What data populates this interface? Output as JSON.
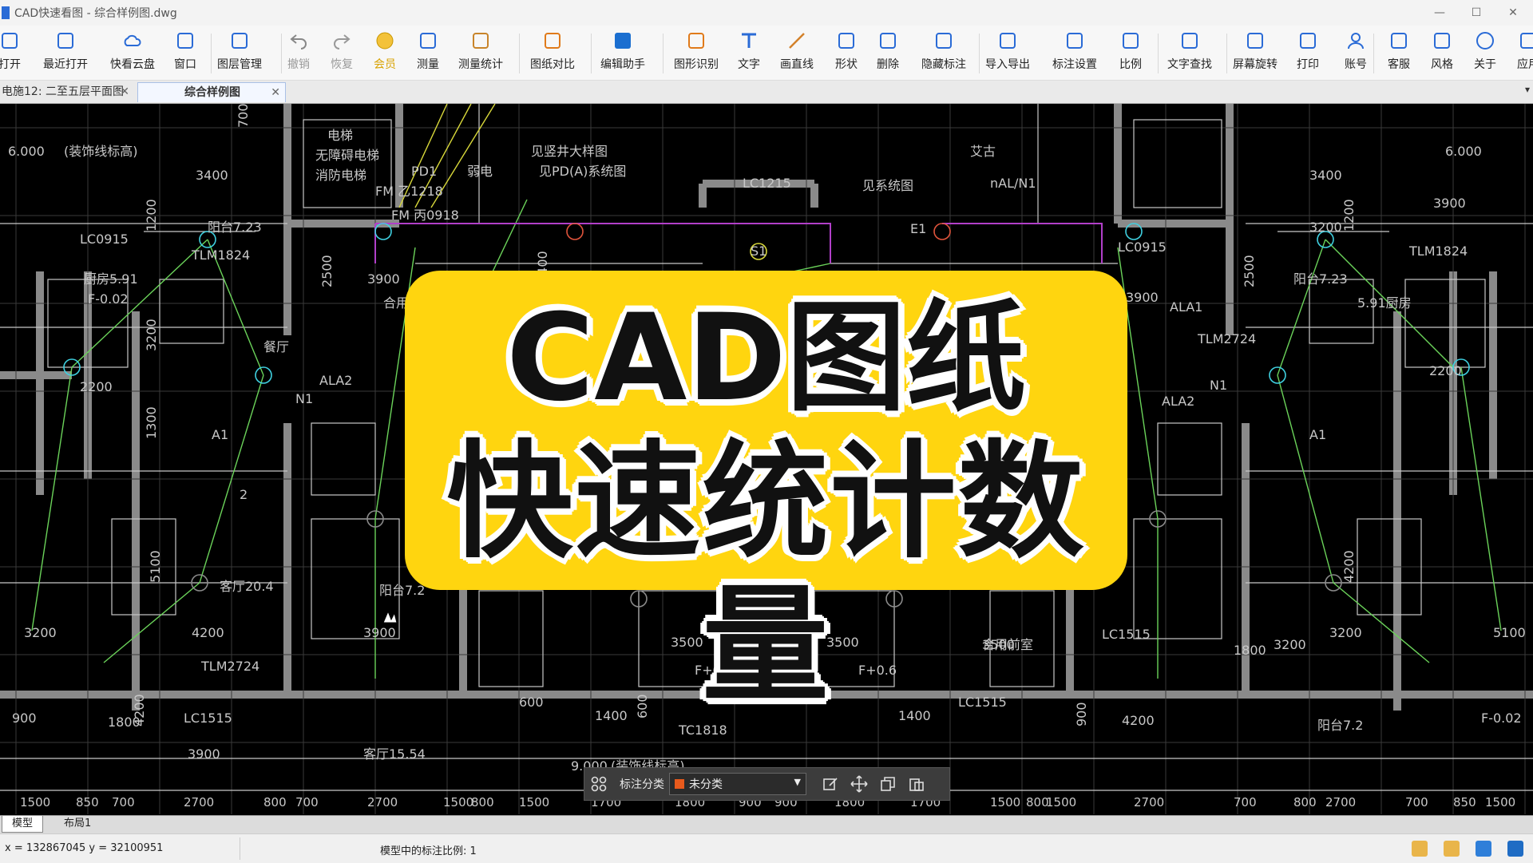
{
  "window": {
    "title": "CAD快速看图 - 综合样例图.dwg",
    "controls": [
      "—",
      "☐",
      "✕"
    ]
  },
  "toolbar": [
    {
      "id": "open",
      "label": "打开",
      "icon": "folder-icon"
    },
    {
      "id": "recent",
      "label": "最近打开",
      "icon": "clock-icon"
    },
    {
      "id": "cloud",
      "label": "快看云盘",
      "icon": "cloud-icon"
    },
    {
      "id": "window",
      "label": "窗口",
      "icon": "window-icon"
    },
    {
      "id": "layers",
      "label": "图层管理",
      "icon": "layers-icon"
    },
    {
      "id": "undo",
      "label": "撤销",
      "icon": "undo-icon"
    },
    {
      "id": "redo",
      "label": "恢复",
      "icon": "redo-icon"
    },
    {
      "id": "vip",
      "label": "会员",
      "icon": "vip-icon"
    },
    {
      "id": "measure",
      "label": "测量",
      "icon": "ruler-icon"
    },
    {
      "id": "measure-stats",
      "label": "测量统计",
      "icon": "chart-icon"
    },
    {
      "id": "compare",
      "label": "图纸对比",
      "icon": "compare-icon"
    },
    {
      "id": "edit-assist",
      "label": "编辑助手",
      "icon": "edit-assistant-icon"
    },
    {
      "id": "shape-recog",
      "label": "图形识别",
      "icon": "shape-recognize-icon"
    },
    {
      "id": "text",
      "label": "文字",
      "icon": "text-icon"
    },
    {
      "id": "line",
      "label": "画直线",
      "icon": "line-icon"
    },
    {
      "id": "shape",
      "label": "形状",
      "icon": "shapes-icon"
    },
    {
      "id": "delete",
      "label": "删除",
      "icon": "eraser-icon"
    },
    {
      "id": "hide-anno",
      "label": "隐藏标注",
      "icon": "eye-hide-icon"
    },
    {
      "id": "import-export",
      "label": "导入导出",
      "icon": "import-export-icon"
    },
    {
      "id": "anno-settings",
      "label": "标注设置",
      "icon": "annotation-settings-icon"
    },
    {
      "id": "scale",
      "label": "比例",
      "icon": "scale-icon"
    },
    {
      "id": "text-search",
      "label": "文字查找",
      "icon": "text-search-icon"
    },
    {
      "id": "rotate",
      "label": "屏幕旋转",
      "icon": "rotate-icon"
    },
    {
      "id": "print",
      "label": "打印",
      "icon": "printer-icon"
    },
    {
      "id": "account",
      "label": "账号",
      "icon": "user-icon"
    },
    {
      "id": "service",
      "label": "客服",
      "icon": "headset-icon"
    },
    {
      "id": "style",
      "label": "风格",
      "icon": "style-icon"
    },
    {
      "id": "about",
      "label": "关于",
      "icon": "info-icon"
    },
    {
      "id": "apps",
      "label": "应用",
      "icon": "cube-icon"
    }
  ],
  "tabs": [
    {
      "label": "电施12: 二至五层平面图",
      "close": "✕",
      "active": false
    },
    {
      "label": "综合样例图",
      "close": "✕",
      "active": true
    }
  ],
  "tabbar_more": "▾",
  "banner": {
    "line1": "CAD图纸",
    "line2": "快速统计数量"
  },
  "drawing_labels": {
    "top_left": [
      "700",
      "6.000",
      "(装饰线标高)",
      "3400",
      "电梯",
      "无障碍电梯",
      "消防电梯",
      "见竖井大样图",
      "PD1",
      "弱电",
      "见PD(A)系统图",
      "厨房5.91",
      "F-0.02",
      "2200",
      "阳台7.23",
      "LC0915",
      "TLM1824",
      "1200",
      "3200",
      "2500",
      "3900",
      "FM 乙1218",
      "FM 丙0918",
      "合用前室",
      "1400",
      "N1",
      "ALA2",
      "A1",
      "1300",
      "2",
      "餐厅",
      "客厅20.4",
      "5100",
      "4200",
      "3200",
      "3900",
      "阳台7.2",
      "TLM2724",
      "LC1515",
      "900",
      "1800",
      "4200",
      "3900",
      "客厅15.54"
    ],
    "top_right": [
      "艾古",
      "nAL/N1",
      "见系统图",
      "ALA1",
      "ALA2",
      "N1",
      "A1",
      "3400",
      "6.000",
      "5.91厨房",
      "2200",
      "3900",
      "2500",
      "1200",
      "3200",
      "阳台7.23",
      "TLM1824",
      "LC0915",
      "合用前室",
      "3500",
      "3200",
      "4200",
      "5100",
      "3200",
      "阳台7.2",
      "4200",
      "3900",
      "LC1515",
      "F-0.02",
      "900",
      "1800",
      "TLM2724"
    ],
    "center": [
      "S1",
      "LC1215",
      "E1",
      "3500",
      "3500",
      "F+0.6",
      "F+0.6",
      "1400",
      "1400",
      "TC1818",
      "600",
      "600",
      "LC1515",
      "9.000",
      "(装饰线标高)"
    ],
    "dims_bottom": [
      "1500",
      "850",
      "700",
      "2700",
      "800",
      "700",
      "2700",
      "1500",
      "800",
      "1500",
      "1700",
      "1800",
      "900",
      "900",
      "1800",
      "1700",
      "1500",
      "800",
      "1500",
      "2700",
      "700",
      "800",
      "2700",
      "700",
      "850",
      "1500"
    ]
  },
  "annotation_bar": {
    "category_label": "标注分类",
    "category_value": "未分类",
    "swatch_color": "#e85a1c",
    "arrow": "▼"
  },
  "layout_tabs": [
    {
      "label": "模型",
      "active": true
    },
    {
      "label": "布局1",
      "active": false
    }
  ],
  "status": {
    "coords": "x = 132867045  y = 32100951",
    "scale_text": "模型中的标注比例: 1"
  }
}
